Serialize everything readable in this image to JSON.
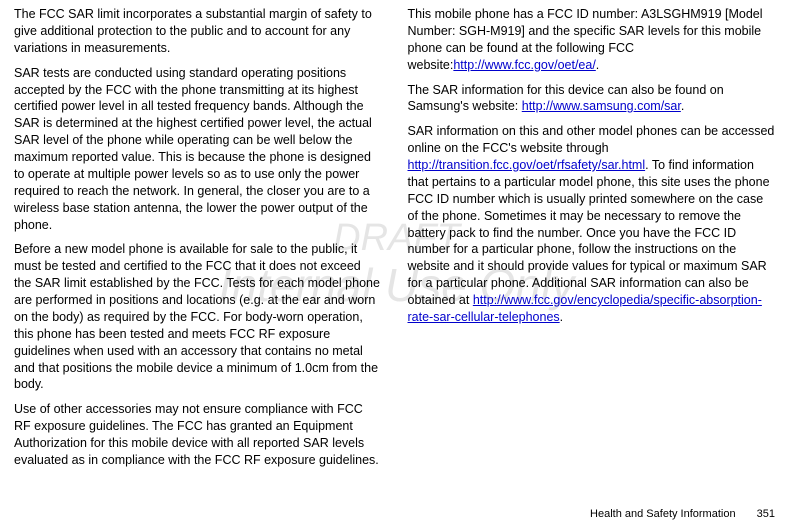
{
  "watermark": {
    "line1": "DRAFT",
    "line2": "Internal Use Only"
  },
  "paragraphs": {
    "p1": "The FCC SAR limit incorporates a substantial margin of safety to give additional protection to the public and to account for any variations in measurements.",
    "p2": "SAR tests are conducted using standard operating positions accepted by the FCC with the phone transmitting at its highest certified power level in all tested frequency bands. Although the SAR is determined at the highest certified power level, the actual SAR level of the phone while operating can be well below the maximum reported value. This is because the phone is designed to operate at multiple power levels so as to use only the power required to reach the network. In general, the closer you are to a wireless base station antenna, the lower the power output of the phone.",
    "p3": "Before a new model phone is available for sale to the public, it must be tested and certified to the FCC that it does not exceed the SAR limit established by the FCC. Tests for each model phone are performed in positions and locations (e.g. at the ear and worn on the body) as required by the FCC. For body-worn operation, this phone has been tested and meets FCC RF exposure guidelines when used with an accessory that contains no metal and that positions the mobile device a minimum of 1.0cm from the body.",
    "p4a": "Use of other accessories may not ensure compliance with FCC RF exposure guidelines. The FCC has granted an Equipment Authorization for this mobile device with all reported SAR levels evaluated as in compliance with the FCC RF exposure guidelines. This mobile phone has a FCC ID number: A3LSGHM919 [Model Number: SGH-M919] and the specific SAR levels for this mobile phone can be found at the following FCC website:",
    "p4_link1": "http://www.fcc.gov/oet/ea/",
    "p5a": "The SAR information for this device can also be found on Samsung's website: ",
    "p5_link": "http://www.samsung.com/sar",
    "p6a": "SAR information on this and other model phones can be accessed online on the FCC's website through ",
    "p6_link1": "http://transition.fcc.gov/oet/rfsafety/sar.html",
    "p6b": ". To find information that pertains to a particular model phone, this site uses the phone FCC ID number which is usually printed somewhere on the case of the phone. Sometimes it may be necessary to remove the battery pack to find the number. Once you have the FCC ID number for a particular phone, follow the instructions on the website and it should provide values for typical or maximum SAR for a particular phone. Additional SAR information can also be obtained at ",
    "p6_link2": "http://www.fcc.gov/encyclopedia/specific-absorption-rate-sar-cellular-telephones"
  },
  "footer": {
    "section": "Health and Safety Information",
    "page": "351"
  }
}
